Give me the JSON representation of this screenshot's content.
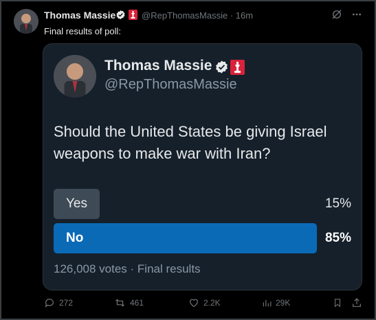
{
  "post": {
    "author_name": "Thomas Massie",
    "handle": "@RepThomasMassie",
    "separator": "·",
    "time": "16m",
    "text": "Final results of poll:"
  },
  "poll": {
    "author_name": "Thomas Massie",
    "handle": "@RepThomasMassie",
    "question": "Should the United States be giving Israel weapons to make war with Iran?",
    "options": [
      {
        "label": "Yes",
        "percent": "15%",
        "share": 0.15,
        "winner": false
      },
      {
        "label": "No",
        "percent": "85%",
        "share": 0.85,
        "winner": true
      }
    ],
    "footer": "126,008 votes · Final results"
  },
  "actions": {
    "replies": "272",
    "reposts": "461",
    "likes": "2.2K",
    "views": "29K"
  },
  "colors": {
    "verified": "#e7e9ea",
    "flag": "#d9233a",
    "winner_bar": "#0a6ab6",
    "loser_bar": "#3e4a55",
    "card_bg": "#15202b"
  },
  "icons": [
    "verified-badge-icon",
    "flag-icon",
    "grok-icon",
    "more-icon",
    "reply-icon",
    "repost-icon",
    "like-icon",
    "views-icon",
    "bookmark-icon",
    "share-icon"
  ]
}
